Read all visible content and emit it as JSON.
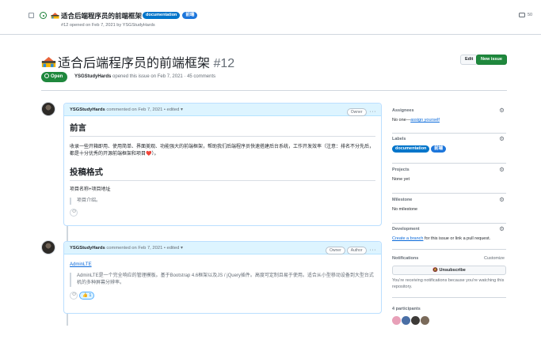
{
  "list_row": {
    "title": "适合后端程序员的前端框架",
    "labels": [
      "documentation",
      "前端"
    ],
    "subtitle": "#12 opened on Feb 7, 2021 by YSGStudyHards",
    "comments_count": "50"
  },
  "issue": {
    "title": "适合后端程序员的前端框架",
    "number": "#12",
    "state": "Open",
    "author": "YSGStudyHards",
    "meta": "opened this issue on Feb 7, 2021 · 45 comments",
    "edit_label": "Edit",
    "new_issue_label": "New issue"
  },
  "comments": [
    {
      "author": "YSGStudyHards",
      "action": "commented on Feb 7, 2021 • edited",
      "roles": [
        "Owner"
      ],
      "heading1": "前言",
      "paragraph": "收录一些开箱即用、使用简单、界面美观、功能强大的前端框架，帮助我们后端程序员快速搭建后台系统，工作开发效率（注意：排名不分先后，都是十分优秀的开源前端框架和项目❤️）。",
      "heading2": "投稿格式",
      "format_line": "项目名称+项目地址",
      "quote": "项目介绍。"
    },
    {
      "author": "YSGStudyHards",
      "action": "commented on Feb 7, 2021 • edited",
      "roles": [
        "Owner",
        "Author"
      ],
      "link": "AdminLTE",
      "quote": "AdminLTE是一个完全响应的管理模板。基于Bootstrap 4.6框架以及JS / jQuery插件。高度可定制且易于使用。适合从小型移动设备到大型台式机的多种屏幕分辨率。",
      "reaction_count": "1"
    }
  ],
  "sidebar": {
    "assignees_title": "Assignees",
    "assignees_value": "No one—",
    "assignees_link": "assign yourself",
    "labels_title": "Labels",
    "labels": [
      "documentation",
      "前端"
    ],
    "projects_title": "Projects",
    "projects_value": "None yet",
    "milestone_title": "Milestone",
    "milestone_value": "No milestone",
    "development_title": "Development",
    "development_link": "Create a branch",
    "development_text": " for this issue or link a pull request.",
    "notifications_title": "Notifications",
    "customize_label": "Customize",
    "unsubscribe_label": "Unsubscribe",
    "notifications_text": "You're receiving notifications because you're watching this repository.",
    "participants_title": "4 participants"
  },
  "colors": {
    "open_green": "#1f883d",
    "label_documentation": "#0075ca",
    "label_frontend": "#1d76db",
    "link_blue": "#0969da"
  }
}
